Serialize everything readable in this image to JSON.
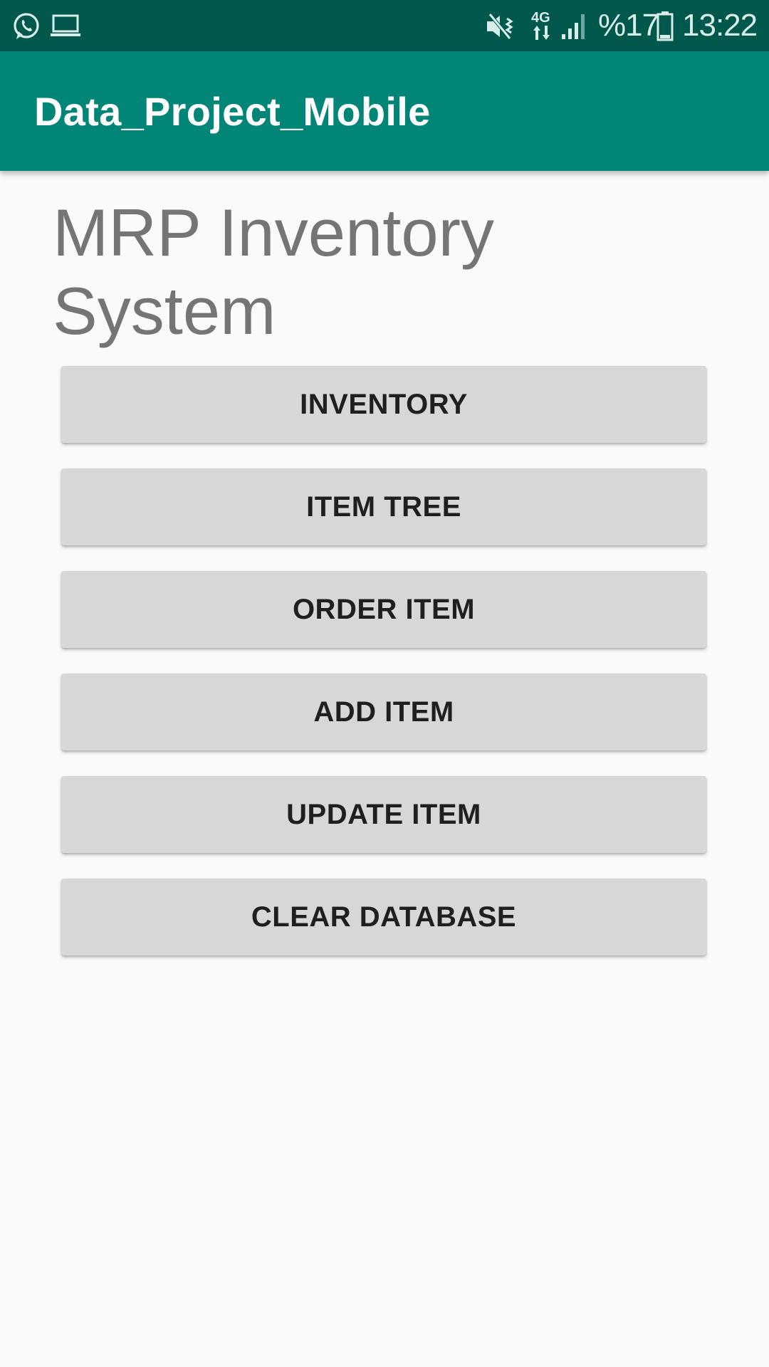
{
  "status_bar": {
    "battery_text": "%17",
    "time": "13:22",
    "network_label": "4G",
    "icons": [
      "whatsapp-icon",
      "laptop-icon",
      "mute-vibrate-icon",
      "4g-data-icon",
      "signal-icon",
      "battery-icon"
    ],
    "background_color": "#00574b"
  },
  "app_bar": {
    "title": "Data_Project_Mobile",
    "background_color": "#008577"
  },
  "main": {
    "heading": "MRP Inventory System",
    "buttons": [
      {
        "label": "INVENTORY"
      },
      {
        "label": "ITEM TREE"
      },
      {
        "label": "ORDER ITEM"
      },
      {
        "label": "ADD ITEM"
      },
      {
        "label": "UPDATE ITEM"
      },
      {
        "label": "CLEAR DATABASE"
      }
    ]
  }
}
